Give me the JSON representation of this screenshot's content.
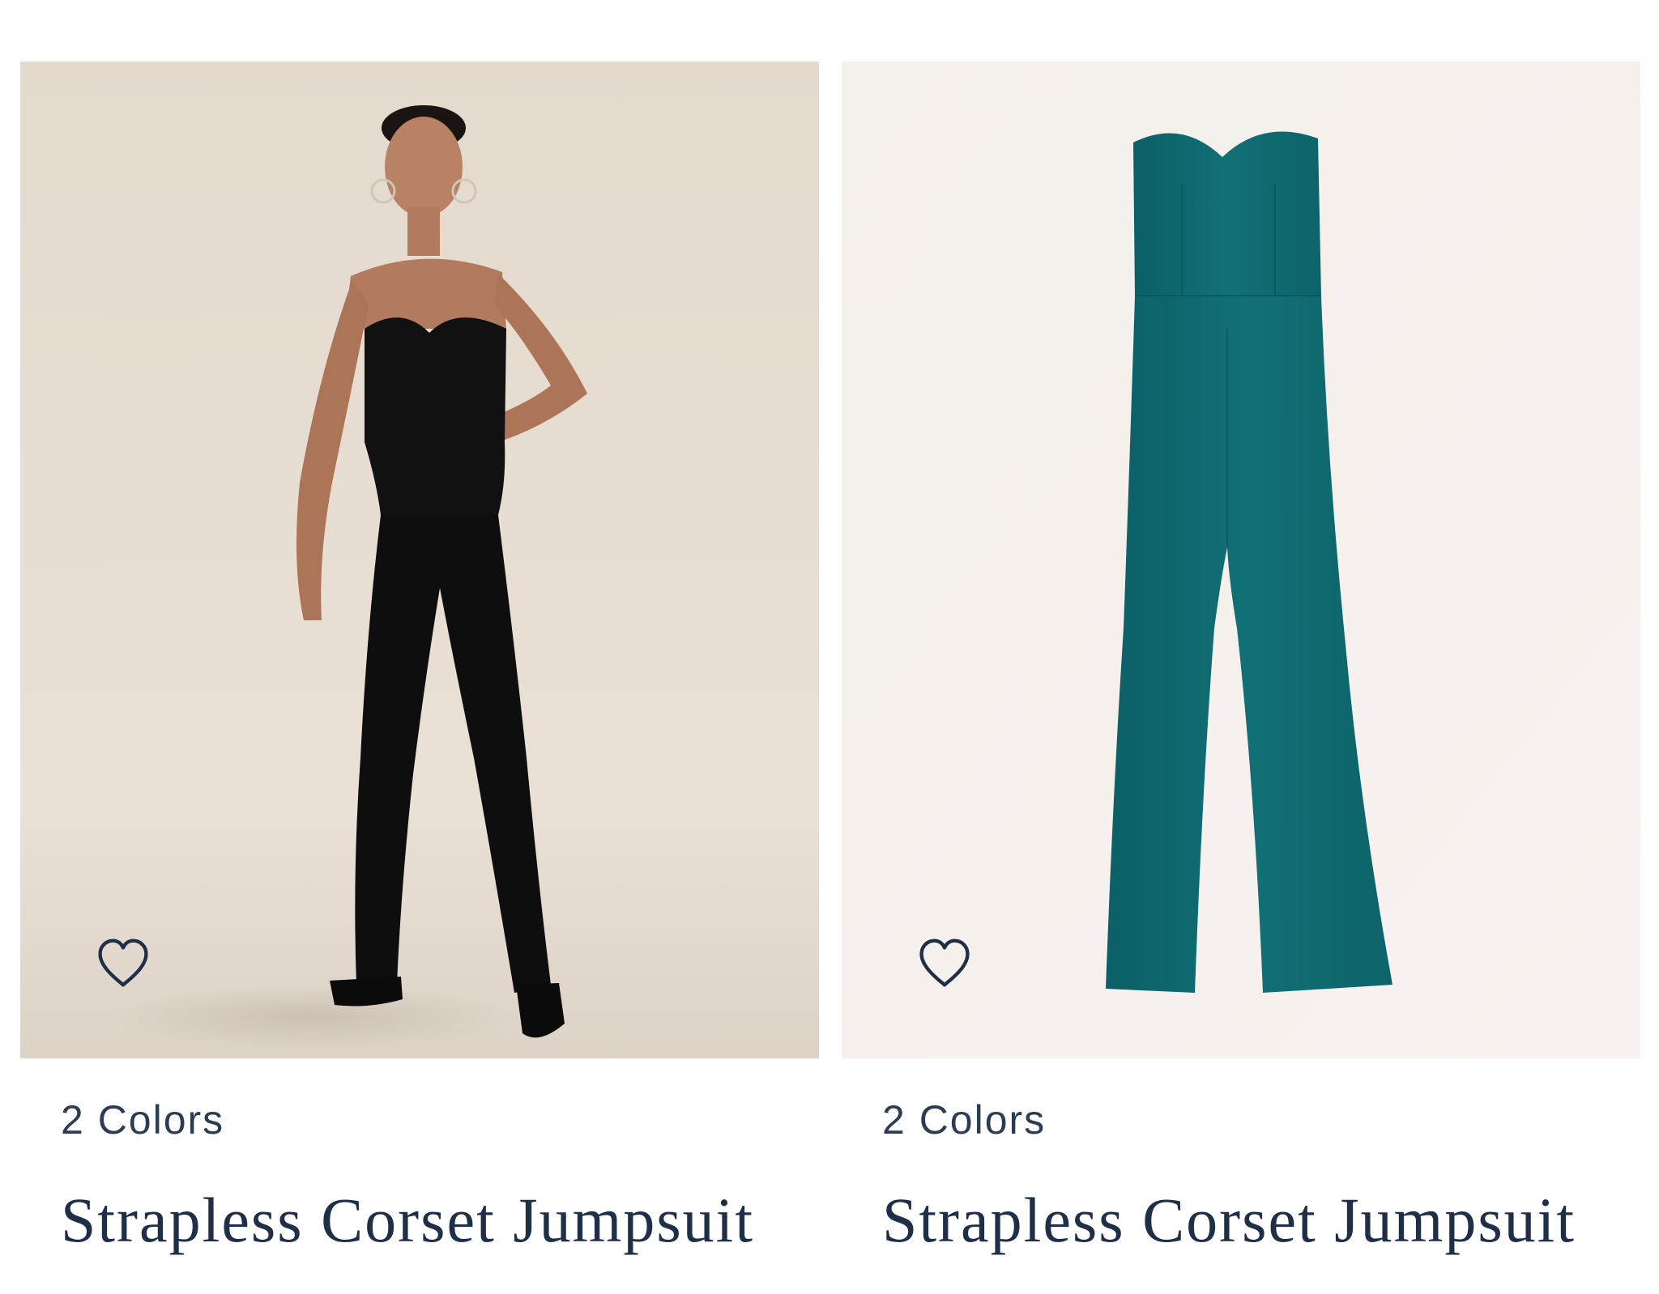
{
  "products": [
    {
      "colors_label": "2 Colors",
      "name": "Strapless Corset Jumpsuit",
      "image_desc": "model-photo",
      "favorite_icon": "heart-outline-icon",
      "garment_color": "#111111",
      "background_color": "#e7ddd2"
    },
    {
      "colors_label": "2 Colors",
      "name": "Strapless Corset Jumpsuit",
      "image_desc": "flat-lay-photo",
      "favorite_icon": "heart-outline-icon",
      "garment_color": "#0f6b70",
      "background_color": "#f6f1ee"
    }
  ],
  "colors": {
    "text_primary": "#1f2f47",
    "text_secondary": "#2b3d55",
    "icon_stroke": "#1f2f47"
  }
}
